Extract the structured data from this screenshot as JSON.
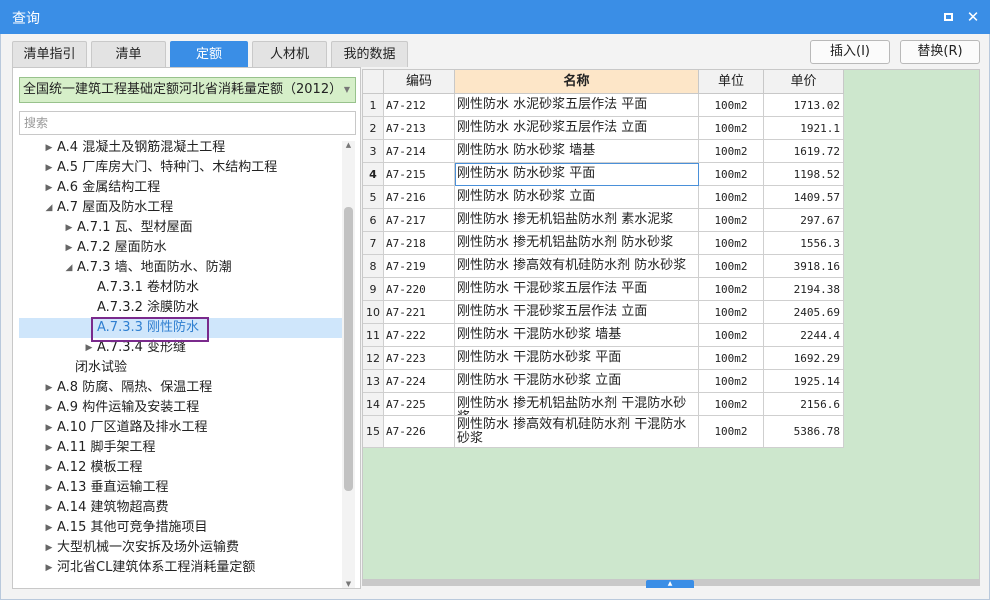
{
  "window": {
    "title": "查询"
  },
  "tabs": [
    {
      "label": "清单指引"
    },
    {
      "label": "清单"
    },
    {
      "label": "定额",
      "active": true
    },
    {
      "label": "人材机"
    },
    {
      "label": "我的数据"
    }
  ],
  "toolbar": {
    "insert_label": "插入(I)",
    "replace_label": "替换(R)"
  },
  "left": {
    "quota_select": "全国统一建筑工程基础定额河北省消耗量定额（2012）",
    "search_placeholder": "搜索",
    "tree": [
      {
        "label": "A.4 混凝土及钢筋混凝土工程",
        "toggle": "▶"
      },
      {
        "label": "A.5 厂库房大门、特种门、木结构工程",
        "toggle": "▶"
      },
      {
        "label": "A.6 金属结构工程",
        "toggle": "▶"
      },
      {
        "label": "A.7 屋面及防水工程",
        "toggle": "◢"
      },
      {
        "label": "A.7.1 瓦、型材屋面",
        "toggle": "▶"
      },
      {
        "label": "A.7.2 屋面防水",
        "toggle": "▶"
      },
      {
        "label": "A.7.3 墙、地面防水、防潮",
        "toggle": "◢"
      },
      {
        "label": "A.7.3.1 卷材防水",
        "toggle": ""
      },
      {
        "label": "A.7.3.2 涂膜防水",
        "toggle": ""
      },
      {
        "label": "A.7.3.3 刚性防水",
        "toggle": "",
        "selected": true
      },
      {
        "label": "A.7.3.4 变形缝",
        "toggle": "▶"
      },
      {
        "label": "闭水试验",
        "toggle": ""
      },
      {
        "label": "A.8 防腐、隔热、保温工程",
        "toggle": "▶"
      },
      {
        "label": "A.9 构件运输及安装工程",
        "toggle": "▶"
      },
      {
        "label": "A.10 厂区道路及排水工程",
        "toggle": "▶"
      },
      {
        "label": "A.11 脚手架工程",
        "toggle": "▶"
      },
      {
        "label": "A.12 模板工程",
        "toggle": "▶"
      },
      {
        "label": "A.13 垂直运输工程",
        "toggle": "▶"
      },
      {
        "label": "A.14 建筑物超高费",
        "toggle": "▶"
      },
      {
        "label": "A.15 其他可竞争措施项目",
        "toggle": "▶"
      },
      {
        "label": "大型机械一次安拆及场外运输费",
        "toggle": "▶"
      },
      {
        "label": "河北省CL建筑体系工程消耗量定额",
        "toggle": "▶"
      }
    ]
  },
  "table": {
    "headers": [
      "编码",
      "名称",
      "单位",
      "单价"
    ],
    "active_header": 1,
    "current_row": 4,
    "rows": [
      {
        "idx": "1",
        "code": "A7-212",
        "name": "刚性防水 水泥砂浆五层作法 平面",
        "unit": "100m2",
        "price": "1713.02"
      },
      {
        "idx": "2",
        "code": "A7-213",
        "name": "刚性防水 水泥砂浆五层作法 立面",
        "unit": "100m2",
        "price": "1921.1"
      },
      {
        "idx": "3",
        "code": "A7-214",
        "name": "刚性防水 防水砂浆 墙基",
        "unit": "100m2",
        "price": "1619.72"
      },
      {
        "idx": "4",
        "code": "A7-215",
        "name": "刚性防水 防水砂浆 平面",
        "unit": "100m2",
        "price": "1198.52"
      },
      {
        "idx": "5",
        "code": "A7-216",
        "name": "刚性防水 防水砂浆 立面",
        "unit": "100m2",
        "price": "1409.57"
      },
      {
        "idx": "6",
        "code": "A7-217",
        "name": "刚性防水 掺无机铝盐防水剂 素水泥浆",
        "unit": "100m2",
        "price": "297.67"
      },
      {
        "idx": "7",
        "code": "A7-218",
        "name": "刚性防水 掺无机铝盐防水剂 防水砂浆",
        "unit": "100m2",
        "price": "1556.3"
      },
      {
        "idx": "8",
        "code": "A7-219",
        "name": "刚性防水 掺高效有机硅防水剂 防水砂浆",
        "unit": "100m2",
        "price": "3918.16"
      },
      {
        "idx": "9",
        "code": "A7-220",
        "name": "刚性防水 干混砂浆五层作法 平面",
        "unit": "100m2",
        "price": "2194.38"
      },
      {
        "idx": "10",
        "code": "A7-221",
        "name": "刚性防水 干混砂浆五层作法 立面",
        "unit": "100m2",
        "price": "2405.69"
      },
      {
        "idx": "11",
        "code": "A7-222",
        "name": "刚性防水 干混防水砂浆 墙基",
        "unit": "100m2",
        "price": "2244.4"
      },
      {
        "idx": "12",
        "code": "A7-223",
        "name": "刚性防水 干混防水砂浆 平面",
        "unit": "100m2",
        "price": "1692.29"
      },
      {
        "idx": "13",
        "code": "A7-224",
        "name": "刚性防水 干混防水砂浆 立面",
        "unit": "100m2",
        "price": "1925.14"
      },
      {
        "idx": "14",
        "code": "A7-225",
        "name": "刚性防水 掺无机铝盐防水剂 干混防水砂浆",
        "unit": "100m2",
        "price": "2156.6"
      },
      {
        "idx": "15",
        "code": "A7-226",
        "name": "刚性防水 掺高效有机硅防水剂 干混防水砂浆",
        "unit": "100m2",
        "price": "5386.78"
      }
    ]
  },
  "colors": {
    "accent": "#3a8ee6",
    "quota_select_bg": "#d6efc9",
    "table_empty_bg": "#cde7cd",
    "header_active_bg": "#fde6c8",
    "selection_outline": "#7a2a8c"
  }
}
